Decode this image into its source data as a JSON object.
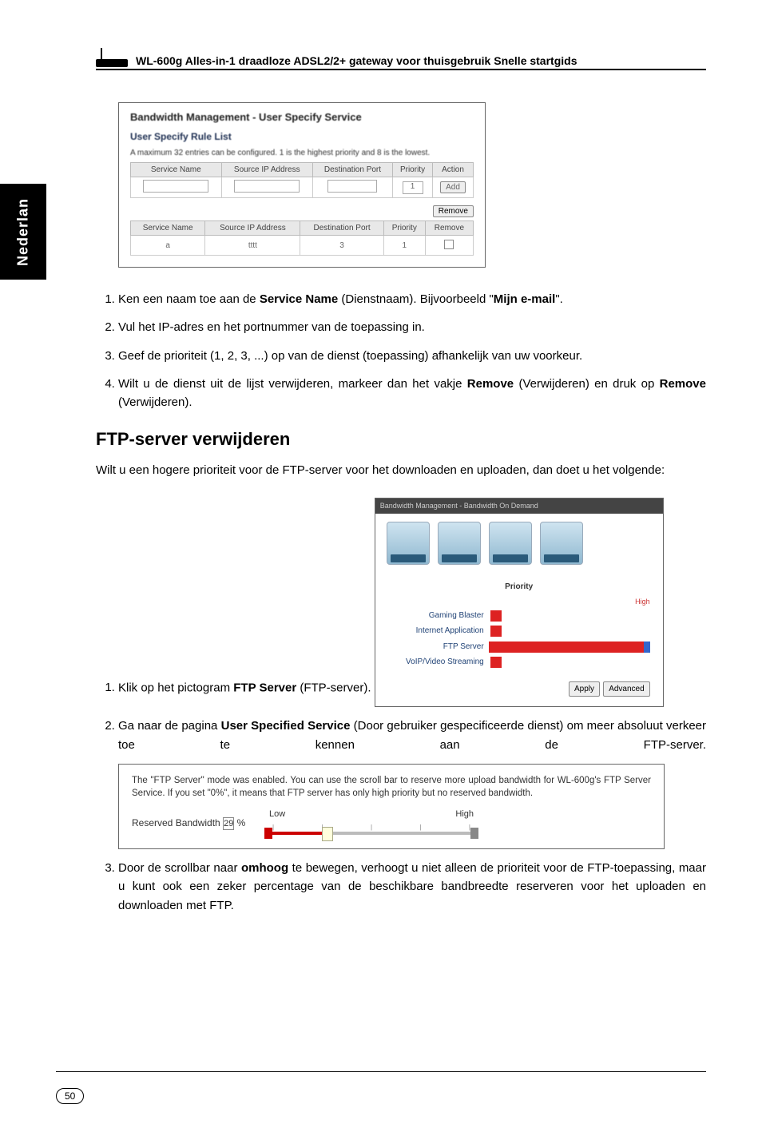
{
  "sideTab": "Nederlan",
  "headerTitle": "WL-600g Alles-in-1 draadloze ADSL2/2+ gateway voor thuisgebruik Snelle startgids",
  "shot1": {
    "title": "Bandwidth Management - User Specify Service",
    "subtitle": "User Specify Rule List",
    "desc": "A maximum 32 entries can be configured. 1 is the highest priority and 8 is the lowest.",
    "cols": [
      "Service Name",
      "Source IP Address",
      "Destination Port",
      "Priority",
      "Action"
    ],
    "cols2": [
      "Service Name",
      "Source IP Address",
      "Destination Port",
      "Priority",
      "Remove"
    ],
    "priVal": "1",
    "removeBtn": "Remove",
    "row2": {
      "port": "3",
      "pri": "1"
    },
    "tttt": "tttt"
  },
  "list1": {
    "i1a": "Ken een naam toe aan de ",
    "i1b": "Service Name",
    "i1c": " (Dienstnaam). Bijvoorbeeld \"",
    "i1d": "Mijn e-mail",
    "i1e": "\".",
    "i2": "Vul het IP-adres en het portnummer van de toepassing in.",
    "i3": "Geef de prioriteit (1, 2, 3, ...) op van de dienst (toepassing) afhankelijk van uw voorkeur.",
    "i4a": "Wilt u de dienst uit de lijst verwijderen, markeer dan het vakje ",
    "i4b": "Remove",
    "i4c": " (Verwijderen) en druk op ",
    "i4d": "Remove",
    "i4e": " (Verwijderen)."
  },
  "sectionTitle": "FTP-server verwijderen",
  "intro": "Wilt u een hogere prioriteit voor de FTP-server voor het downloaden en uploaden, dan doet u het volgende:",
  "list2": {
    "i1a": "Klik op het pictogram ",
    "i1b": "FTP Server",
    "i1c": " (FTP-server).",
    "i2a": "Ga naar de pagina ",
    "i2b": "User Specified Service",
    "i2c": " (Door gebruiker gespecificeerde dienst) om meer absoluut verkeer toe te kennen aan de FTP-server.",
    "i3a": "Door de scrollbar naar ",
    "i3b": "omhoog",
    "i3c": " te bewegen, verhoogt u niet alleen de prioriteit voor de FTP-toepassing, maar u kunt ook een zeker percentage van de beschikbare bandbreedte reserveren voor het uploaden en downloaden met FTP."
  },
  "shot2": {
    "topbar": "Bandwidth Management - Bandwidth On Demand",
    "priority": "Priority",
    "high": "High",
    "rows": [
      "Gaming Blaster",
      "Internet Application",
      "FTP Server",
      "VoIP/Video Streaming"
    ],
    "apply": "Apply",
    "advanced": "Advanced"
  },
  "shot3": {
    "note": "The \"FTP Server\" mode was enabled. You can use the scroll bar to reserve more upload bandwidth for WL-600g's FTP Server Service. If you set \"0%\", it means that FTP server has only high priority but no reserved bandwidth.",
    "low": "Low",
    "high": "High",
    "label": "Reserved Bandwidth",
    "pct": "29",
    "pctSuffix": "%"
  },
  "pageNumber": "50"
}
